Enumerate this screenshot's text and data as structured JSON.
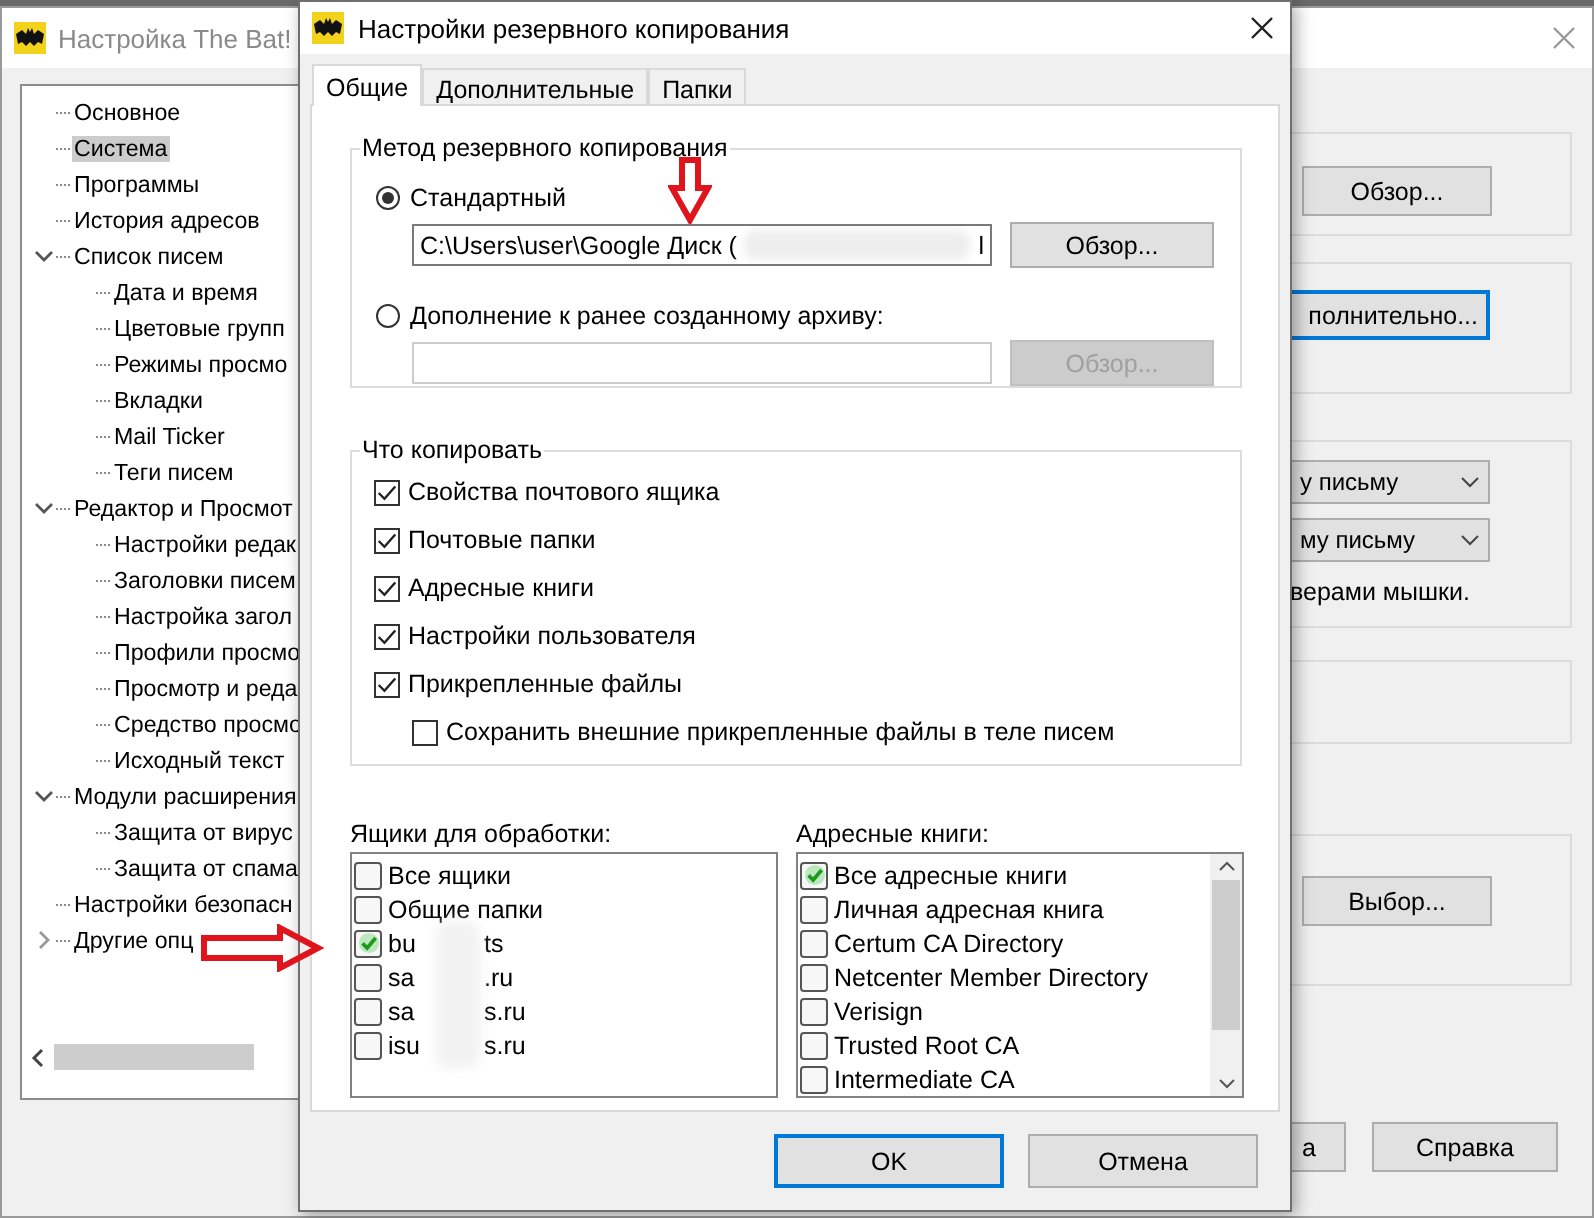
{
  "background_window": {
    "title": "Настройка The Bat!",
    "tree": [
      {
        "label": "Основное",
        "selected": false
      },
      {
        "label": "Система",
        "selected": true
      },
      {
        "label": "Программы",
        "selected": false
      },
      {
        "label": "История адресов",
        "selected": false
      },
      {
        "label": "Список писем",
        "selected": false,
        "expanded": true,
        "children": [
          {
            "label": "Дата и время",
            "selected": false
          },
          {
            "label": "Цветовые групп",
            "selected": false
          },
          {
            "label": "Режимы просмо",
            "selected": false
          },
          {
            "label": "Вкладки",
            "selected": false
          },
          {
            "label": "Mail Ticker",
            "selected": false
          },
          {
            "label": "Теги писем",
            "selected": false
          }
        ]
      },
      {
        "label": "Редактор и Просмот",
        "selected": false,
        "expanded": true,
        "children": [
          {
            "label": "Настройки редак",
            "selected": false
          },
          {
            "label": "Заголовки писем",
            "selected": false
          },
          {
            "label": "Настройка загол",
            "selected": false
          },
          {
            "label": "Профили просмо",
            "selected": false
          },
          {
            "label": "Просмотр и реда",
            "selected": false
          },
          {
            "label": "Средство просмо",
            "selected": false
          },
          {
            "label": "Исходный текст",
            "selected": false
          }
        ]
      },
      {
        "label": "Модули расширения",
        "selected": false,
        "expanded": true,
        "children": [
          {
            "label": "Защита от вирус",
            "selected": false
          },
          {
            "label": "Защита от спама",
            "selected": false
          }
        ]
      },
      {
        "label": "Настройки безопасн",
        "selected": false
      },
      {
        "label": "Другие опц",
        "selected": false,
        "expanded": false
      }
    ],
    "right_panel": {
      "browse_button": "Обзор...",
      "advanced_button": "полнительно...",
      "dropdowns": [
        "у письму",
        "му письму"
      ],
      "note": "верами мышки.",
      "choose_button": "Выбор...",
      "bottom_buttons": [
        "а",
        "Справка"
      ]
    }
  },
  "dialog": {
    "title": "Настройки резервного копирования",
    "tabs": [
      {
        "label": "Общие",
        "selected": true
      },
      {
        "label": "Дополнительные",
        "selected": false
      },
      {
        "label": "Папки",
        "selected": false
      }
    ],
    "method_group": {
      "title": "Метод резервного копирования",
      "options": [
        {
          "label": "Стандартный",
          "selected": true,
          "path": "C:\\Users\\user\\Google Диск (",
          "path_end": "l",
          "button": "Обзор...",
          "disabled": false
        },
        {
          "label": "Дополнение к ранее созданному архиву:",
          "selected": false,
          "button": "Обзор...",
          "disabled": true
        }
      ]
    },
    "copy_group": {
      "title": "Что копировать",
      "items": [
        {
          "label": "Свойства почтового ящика",
          "checked": true,
          "indented": false
        },
        {
          "label": "Почтовые папки",
          "checked": true,
          "indented": false
        },
        {
          "label": "Адресные книги",
          "checked": true,
          "indented": false
        },
        {
          "label": "Настройки пользователя",
          "checked": true,
          "indented": false
        },
        {
          "label": "Прикрепленные файлы",
          "checked": true,
          "indented": false
        },
        {
          "label": "Сохранить внешние прикрепленные файлы в теле писем",
          "checked": false,
          "indented": true
        }
      ]
    },
    "mailboxes": {
      "title": "Ящики для обработки:",
      "items": [
        {
          "label": "Все ящики",
          "checked": false
        },
        {
          "label": "Общие папки",
          "checked": false
        },
        {
          "label": "bu",
          "suffix": "ts",
          "checked": true
        },
        {
          "label": "sa",
          "suffix": ".ru",
          "checked": false
        },
        {
          "label": "sa",
          "suffix": "s.ru",
          "checked": false
        },
        {
          "label": "isu",
          "suffix": "s.ru",
          "checked": false
        }
      ]
    },
    "address_books": {
      "title": "Адресные книги:",
      "items": [
        {
          "label": "Все адресные книги",
          "checked": true
        },
        {
          "label": "Личная адресная книга",
          "checked": false
        },
        {
          "label": "Certum CA Directory",
          "checked": false
        },
        {
          "label": "Netcenter Member Directory",
          "checked": false
        },
        {
          "label": "Verisign",
          "checked": false
        },
        {
          "label": "Trusted Root CA",
          "checked": false
        },
        {
          "label": "Intermediate CA",
          "checked": false
        }
      ]
    },
    "buttons": [
      "OK",
      "Отмена"
    ]
  }
}
